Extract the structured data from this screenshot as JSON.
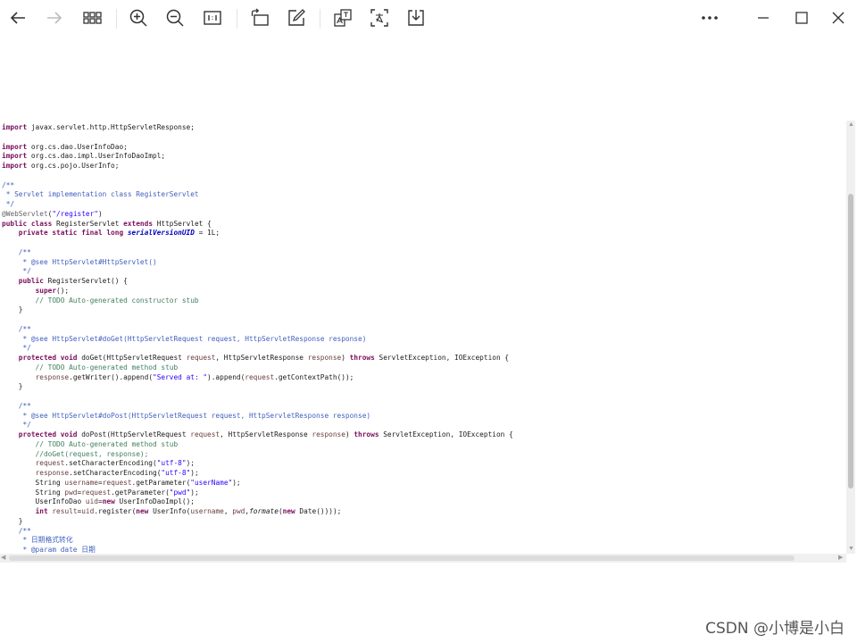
{
  "toolbar": {
    "buttons": [
      {
        "id": "back",
        "icon": "arrow-left-icon"
      },
      {
        "id": "forward",
        "icon": "arrow-right-icon"
      },
      {
        "id": "thumbnails",
        "icon": "grid-icon"
      },
      {
        "id": "zoom-in",
        "icon": "zoom-in-icon"
      },
      {
        "id": "zoom-out",
        "icon": "zoom-out-icon"
      },
      {
        "id": "actual-size",
        "icon": "actual-size-icon"
      },
      {
        "id": "rotate",
        "icon": "rotate-icon"
      },
      {
        "id": "edit",
        "icon": "edit-icon"
      },
      {
        "id": "translate",
        "icon": "translate-icon"
      },
      {
        "id": "ocr",
        "icon": "ocr-text-icon"
      },
      {
        "id": "save",
        "icon": "download-icon"
      },
      {
        "id": "more",
        "icon": "more-icon"
      },
      {
        "id": "minimize",
        "icon": "minimize-icon"
      },
      {
        "id": "maximize",
        "icon": "maximize-icon"
      },
      {
        "id": "close",
        "icon": "close-icon"
      }
    ]
  },
  "code": {
    "lines": [
      [
        [
          "kw",
          "import"
        ],
        [
          "t",
          " javax.servlet.http.HttpServletResponse;"
        ]
      ],
      [],
      [
        [
          "kw",
          "import"
        ],
        [
          "t",
          " org.cs.dao.UserInfoDao;"
        ]
      ],
      [
        [
          "kw",
          "import"
        ],
        [
          "t",
          " org.cs.dao.impl.UserInfoDaoImpl;"
        ]
      ],
      [
        [
          "kw",
          "import"
        ],
        [
          "t",
          " org.cs.pojo.UserInfo;"
        ]
      ],
      [],
      [
        [
          "jd",
          "/**"
        ]
      ],
      [
        [
          "jd",
          " * Servlet implementation class RegisterServlet"
        ]
      ],
      [
        [
          "jd",
          " */"
        ]
      ],
      [
        [
          "an",
          "@WebServlet"
        ],
        [
          "t",
          "("
        ],
        [
          "st",
          "\"/register\""
        ],
        [
          "t",
          ")"
        ]
      ],
      [
        [
          "kw",
          "public class"
        ],
        [
          "t",
          " RegisterServlet "
        ],
        [
          "kw",
          "extends"
        ],
        [
          "t",
          " HttpServlet {"
        ]
      ],
      [
        [
          "t",
          "    "
        ],
        [
          "kw",
          "private static final long"
        ],
        [
          "t",
          " "
        ],
        [
          "fd",
          "serialVersionUID"
        ],
        [
          "t",
          " = 1L;"
        ]
      ],
      [],
      [
        [
          "jd",
          "    /**"
        ]
      ],
      [
        [
          "jd",
          "     * @see HttpServlet#HttpServlet()"
        ]
      ],
      [
        [
          "jd",
          "     */"
        ]
      ],
      [
        [
          "t",
          "    "
        ],
        [
          "kw",
          "public"
        ],
        [
          "t",
          " RegisterServlet() {"
        ]
      ],
      [
        [
          "t",
          "        "
        ],
        [
          "kw",
          "super"
        ],
        [
          "t",
          "();"
        ]
      ],
      [
        [
          "cm",
          "        // TODO Auto-generated constructor stub"
        ]
      ],
      [
        [
          "t",
          "    }"
        ]
      ],
      [],
      [
        [
          "jd",
          "    /**"
        ]
      ],
      [
        [
          "jd",
          "     * @see HttpServlet#doGet(HttpServletRequest request, HttpServletResponse response)"
        ]
      ],
      [
        [
          "jd",
          "     */"
        ]
      ],
      [
        [
          "t",
          "    "
        ],
        [
          "kw",
          "protected void"
        ],
        [
          "t",
          " doGet(HttpServletRequest "
        ],
        [
          "pr",
          "request"
        ],
        [
          "t",
          ", HttpServletResponse "
        ],
        [
          "pr",
          "response"
        ],
        [
          "t",
          ") "
        ],
        [
          "kw",
          "throws"
        ],
        [
          "t",
          " ServletException, IOException {"
        ]
      ],
      [
        [
          "cm",
          "        // TODO Auto-generated method stub"
        ]
      ],
      [
        [
          "t",
          "        "
        ],
        [
          "pr",
          "response"
        ],
        [
          "t",
          ".getWriter().append("
        ],
        [
          "st",
          "\"Served at: \""
        ],
        [
          "t",
          ").append("
        ],
        [
          "pr",
          "request"
        ],
        [
          "t",
          ".getContextPath());"
        ]
      ],
      [
        [
          "t",
          "    }"
        ]
      ],
      [],
      [
        [
          "jd",
          "    /**"
        ]
      ],
      [
        [
          "jd",
          "     * @see HttpServlet#doPost(HttpServletRequest request, HttpServletResponse response)"
        ]
      ],
      [
        [
          "jd",
          "     */"
        ]
      ],
      [
        [
          "t",
          "    "
        ],
        [
          "kw",
          "protected void"
        ],
        [
          "t",
          " doPost(HttpServletRequest "
        ],
        [
          "pr",
          "request"
        ],
        [
          "t",
          ", HttpServletResponse "
        ],
        [
          "pr",
          "response"
        ],
        [
          "t",
          ") "
        ],
        [
          "kw",
          "throws"
        ],
        [
          "t",
          " ServletException, IOException {"
        ]
      ],
      [
        [
          "cm",
          "        // TODO Auto-generated method stub"
        ]
      ],
      [
        [
          "cm",
          "        //doGet(request, response);"
        ]
      ],
      [
        [
          "t",
          "        "
        ],
        [
          "pr",
          "request"
        ],
        [
          "t",
          ".setCharacterEncoding("
        ],
        [
          "st",
          "\"utf-8\""
        ],
        [
          "t",
          ");"
        ]
      ],
      [
        [
          "t",
          "        "
        ],
        [
          "pr",
          "response"
        ],
        [
          "t",
          ".setCharacterEncoding("
        ],
        [
          "st",
          "\"utf-8\""
        ],
        [
          "t",
          ");"
        ]
      ],
      [
        [
          "t",
          "        String "
        ],
        [
          "pr",
          "username"
        ],
        [
          "t",
          "="
        ],
        [
          "pr",
          "request"
        ],
        [
          "t",
          ".getParameter("
        ],
        [
          "st",
          "\"userName\""
        ],
        [
          "t",
          ");"
        ]
      ],
      [
        [
          "t",
          "        String "
        ],
        [
          "pr",
          "pwd"
        ],
        [
          "t",
          "="
        ],
        [
          "pr",
          "request"
        ],
        [
          "t",
          ".getParameter("
        ],
        [
          "st",
          "\"pwd\""
        ],
        [
          "t",
          ");"
        ]
      ],
      [
        [
          "t",
          "        UserInfoDao "
        ],
        [
          "pr",
          "uid"
        ],
        [
          "t",
          "="
        ],
        [
          "kw",
          "new"
        ],
        [
          "t",
          " UserInfoDaoImpl();"
        ]
      ],
      [
        [
          "t",
          "        "
        ],
        [
          "kw",
          "int"
        ],
        [
          "t",
          " "
        ],
        [
          "pr",
          "result"
        ],
        [
          "t",
          "="
        ],
        [
          "pr",
          "uid"
        ],
        [
          "t",
          ".register("
        ],
        [
          "kw",
          "new"
        ],
        [
          "t",
          " UserInfo("
        ],
        [
          "pr",
          "username"
        ],
        [
          "t",
          ", "
        ],
        [
          "pr",
          "pwd"
        ],
        [
          "t",
          ","
        ],
        [
          "it",
          "formate"
        ],
        [
          "t",
          "("
        ],
        [
          "kw",
          "new"
        ],
        [
          "t",
          " Date())));"
        ]
      ],
      [
        [
          "t",
          "    }"
        ]
      ],
      [
        [
          "jd",
          "    /**"
        ]
      ],
      [
        [
          "jd",
          "     * 日期格式转化"
        ]
      ],
      [
        [
          "jd",
          "     * @param date 日期"
        ]
      ]
    ]
  },
  "watermark": "CSDN @小博是小白",
  "scroll": {
    "left_arrow": "◀",
    "right_arrow": "▶",
    "up_arrow": "▲",
    "down_arrow": "▼"
  }
}
